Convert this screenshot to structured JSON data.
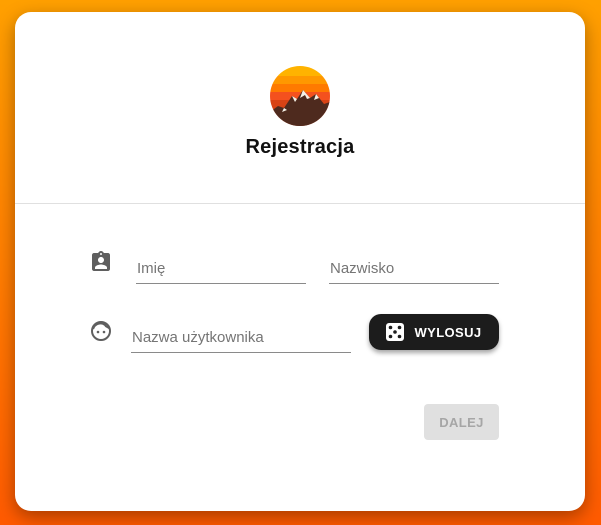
{
  "header": {
    "title": "Rejestracja",
    "logo_icon": "mountain-sunset-logo"
  },
  "form": {
    "first_name": {
      "placeholder": "Imię",
      "value": ""
    },
    "last_name": {
      "placeholder": "Nazwisko",
      "value": ""
    },
    "username": {
      "placeholder": "Nazwa użytkownika",
      "value": ""
    },
    "name_icon": "contact-badge-icon",
    "username_icon": "face-icon"
  },
  "actions": {
    "random_label": "WYLOSUJ",
    "random_icon": "dice-icon",
    "next_label": "DALEJ",
    "next_disabled": true
  },
  "colors": {
    "background_top": "#ffa000",
    "background_bottom": "#ff5a00",
    "random_button": "#1c1c1c",
    "next_button_disabled": "#e0e0e0"
  }
}
